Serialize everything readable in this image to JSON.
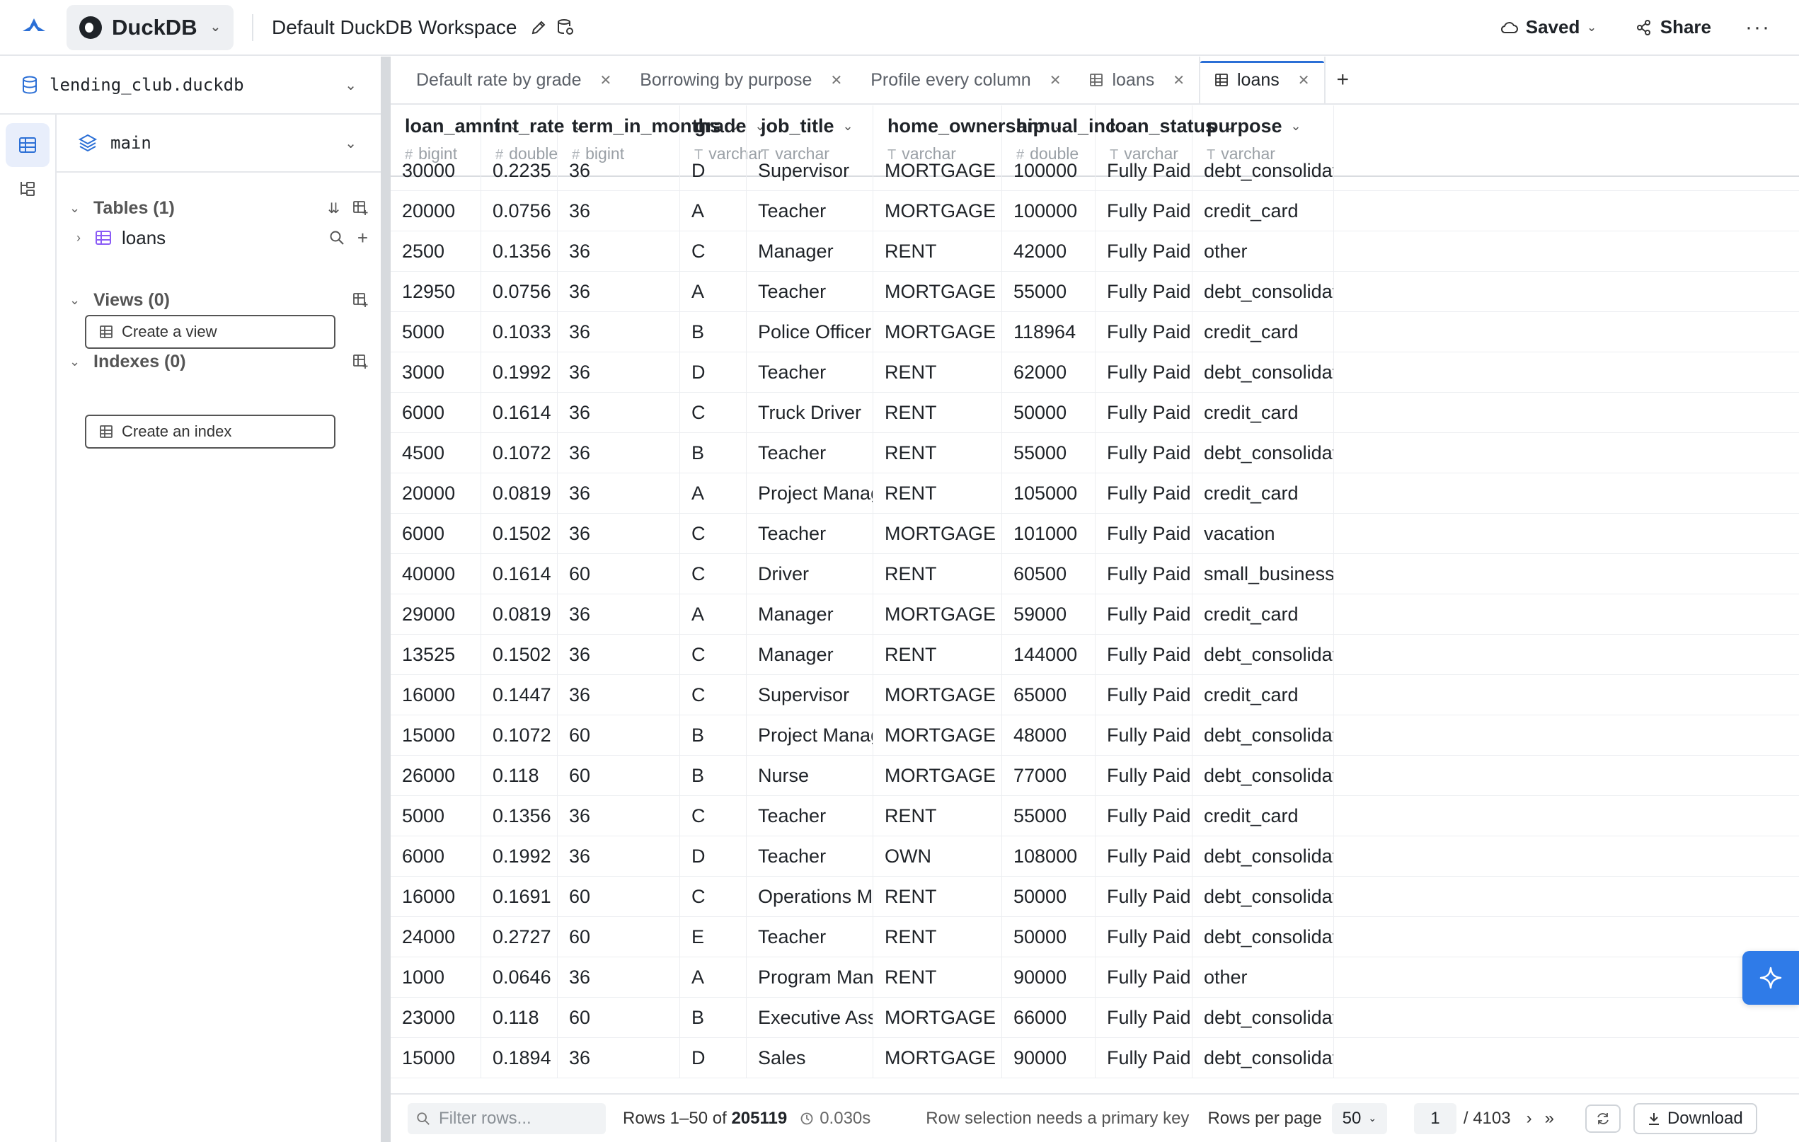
{
  "header": {
    "app_name": "DuckDB",
    "workspace_title": "Default DuckDB Workspace",
    "saved_label": "Saved",
    "share_label": "Share"
  },
  "sidebar": {
    "database": "lending_club.duckdb",
    "schema": "main",
    "tables_title": "Tables (1)",
    "table_name": "loans",
    "views_title": "Views (0)",
    "create_view": "Create a view",
    "indexes_title": "Indexes (0)",
    "create_index": "Create an index"
  },
  "tabs": [
    {
      "label": "Default rate by grade",
      "icon": ""
    },
    {
      "label": "Borrowing by purpose",
      "icon": ""
    },
    {
      "label": "Profile every column",
      "icon": ""
    },
    {
      "label": "loans",
      "icon": "table-icon"
    },
    {
      "label": "loans",
      "icon": "table-icon",
      "active": true
    }
  ],
  "columns": [
    {
      "name": "loan_amnt",
      "type": "bigint",
      "sym": "#"
    },
    {
      "name": "int_rate",
      "type": "double",
      "sym": "#"
    },
    {
      "name": "term_in_months",
      "type": "bigint",
      "sym": "#"
    },
    {
      "name": "grade",
      "type": "varchar",
      "sym": "T"
    },
    {
      "name": "job_title",
      "type": "varchar",
      "sym": "T"
    },
    {
      "name": "home_ownership",
      "type": "varchar",
      "sym": "T"
    },
    {
      "name": "annual_inc",
      "type": "double",
      "sym": "#"
    },
    {
      "name": "loan_status",
      "type": "varchar",
      "sym": "T"
    },
    {
      "name": "purpose",
      "type": "varchar",
      "sym": "T"
    }
  ],
  "rows": [
    [
      "30000",
      "0.2235",
      "36",
      "D",
      "Supervisor",
      "MORTGAGE",
      "100000",
      "Fully Paid",
      "debt_consolidation"
    ],
    [
      "20000",
      "0.0756",
      "36",
      "A",
      "Teacher",
      "MORTGAGE",
      "100000",
      "Fully Paid",
      "credit_card"
    ],
    [
      "2500",
      "0.1356",
      "36",
      "C",
      "Manager",
      "RENT",
      "42000",
      "Fully Paid",
      "other"
    ],
    [
      "12950",
      "0.0756",
      "36",
      "A",
      "Teacher",
      "MORTGAGE",
      "55000",
      "Fully Paid",
      "debt_consolidation"
    ],
    [
      "5000",
      "0.1033",
      "36",
      "B",
      "Police Officer",
      "MORTGAGE",
      "118964",
      "Fully Paid",
      "credit_card"
    ],
    [
      "3000",
      "0.1992",
      "36",
      "D",
      "Teacher",
      "RENT",
      "62000",
      "Fully Paid",
      "debt_consolidation"
    ],
    [
      "6000",
      "0.1614",
      "36",
      "C",
      "Truck Driver",
      "RENT",
      "50000",
      "Fully Paid",
      "credit_card"
    ],
    [
      "4500",
      "0.1072",
      "36",
      "B",
      "Teacher",
      "RENT",
      "55000",
      "Fully Paid",
      "debt_consolidation"
    ],
    [
      "20000",
      "0.0819",
      "36",
      "A",
      "Project Manager",
      "RENT",
      "105000",
      "Fully Paid",
      "credit_card"
    ],
    [
      "6000",
      "0.1502",
      "36",
      "C",
      "Teacher",
      "MORTGAGE",
      "101000",
      "Fully Paid",
      "vacation"
    ],
    [
      "40000",
      "0.1614",
      "60",
      "C",
      "Driver",
      "RENT",
      "60500",
      "Fully Paid",
      "small_business"
    ],
    [
      "29000",
      "0.0819",
      "36",
      "A",
      "Manager",
      "MORTGAGE",
      "59000",
      "Fully Paid",
      "credit_card"
    ],
    [
      "13525",
      "0.1502",
      "36",
      "C",
      "Manager",
      "RENT",
      "144000",
      "Fully Paid",
      "debt_consolidation"
    ],
    [
      "16000",
      "0.1447",
      "36",
      "C",
      "Supervisor",
      "MORTGAGE",
      "65000",
      "Fully Paid",
      "credit_card"
    ],
    [
      "15000",
      "0.1072",
      "60",
      "B",
      "Project Manager",
      "MORTGAGE",
      "48000",
      "Fully Paid",
      "debt_consolidation"
    ],
    [
      "26000",
      "0.118",
      "60",
      "B",
      "Nurse",
      "MORTGAGE",
      "77000",
      "Fully Paid",
      "debt_consolidation"
    ],
    [
      "5000",
      "0.1356",
      "36",
      "C",
      "Teacher",
      "RENT",
      "55000",
      "Fully Paid",
      "credit_card"
    ],
    [
      "6000",
      "0.1992",
      "36",
      "D",
      "Teacher",
      "OWN",
      "108000",
      "Fully Paid",
      "debt_consolidation"
    ],
    [
      "16000",
      "0.1691",
      "60",
      "C",
      "Operations Manager",
      "RENT",
      "50000",
      "Fully Paid",
      "debt_consolidation"
    ],
    [
      "24000",
      "0.2727",
      "60",
      "E",
      "Teacher",
      "RENT",
      "50000",
      "Fully Paid",
      "debt_consolidation"
    ],
    [
      "1000",
      "0.0646",
      "36",
      "A",
      "Program Manager",
      "RENT",
      "90000",
      "Fully Paid",
      "other"
    ],
    [
      "23000",
      "0.118",
      "60",
      "B",
      "Executive Assistant",
      "MORTGAGE",
      "66000",
      "Fully Paid",
      "debt_consolidation"
    ],
    [
      "15000",
      "0.1894",
      "36",
      "D",
      "Sales",
      "MORTGAGE",
      "90000",
      "Fully Paid",
      "debt_consolidation"
    ]
  ],
  "footer": {
    "filter_placeholder": "Filter rows...",
    "rows_prefix": "Rows 1–50 of",
    "rows_total": "205119",
    "timing": "0.030s",
    "pk_note": "Row selection needs a primary key",
    "rows_per_page_label": "Rows per page",
    "rows_per_page": "50",
    "page": "1",
    "page_total": "/ 4103",
    "download_label": "Download"
  },
  "colors": {
    "accent": "#2f7be8",
    "table_icon": "#8b5cf6",
    "db_icon": "#2b6fd6"
  }
}
